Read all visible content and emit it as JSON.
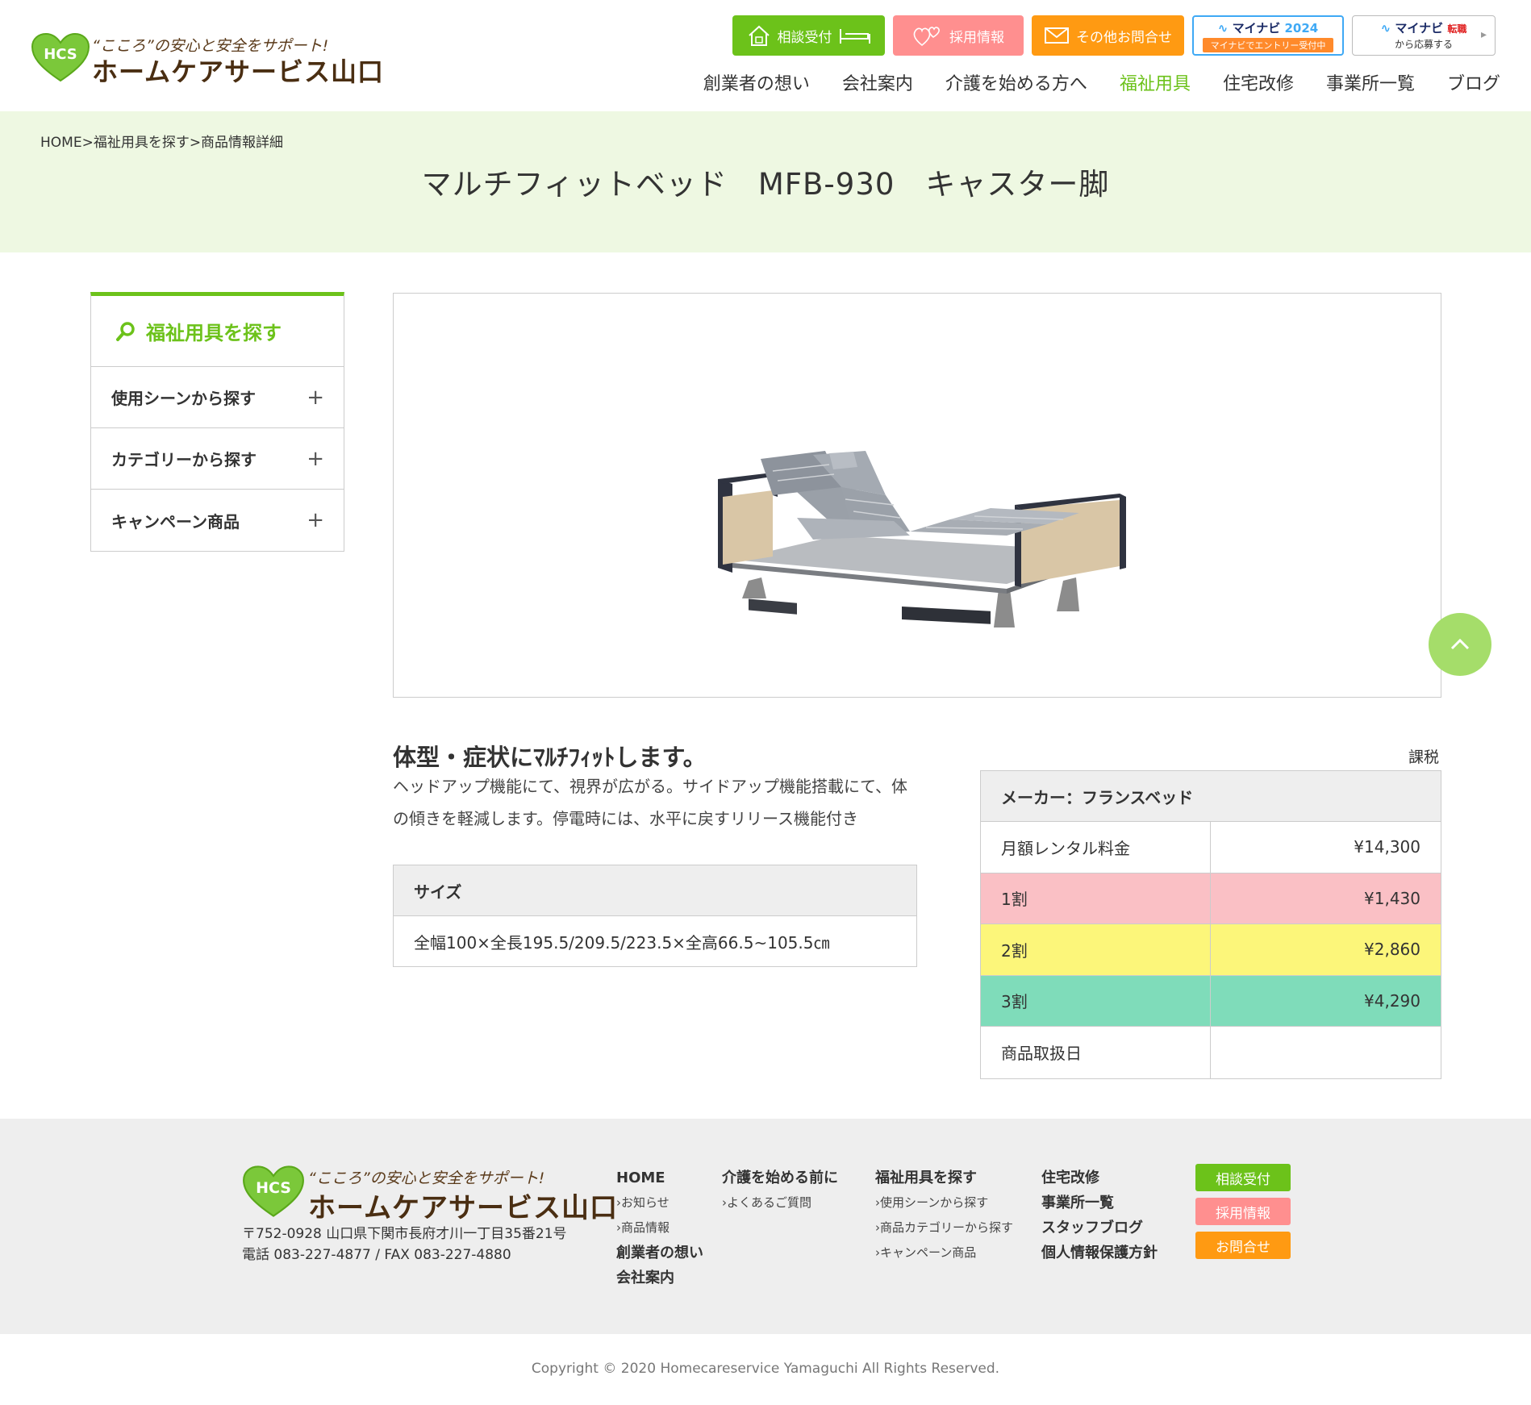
{
  "header": {
    "logo_tagline": "“こころ”の安心と安全をサポート!",
    "logo_name": "ホームケアサービス山口",
    "logo_mark": "HCS",
    "buttons": {
      "consult": "相談受付",
      "recruit": "採用情報",
      "contact": "その他お問合せ"
    },
    "mynavi": {
      "brand": "マイナビ",
      "year": "2024",
      "banner": "マイナビでエントリー受付中"
    },
    "mynavi_tenshoku": {
      "brand": "マイナビ",
      "badge": "転職",
      "sub": "から応募する"
    },
    "nav": [
      "創業者の想い",
      "会社案内",
      "介護を始める方へ",
      "福祉用具",
      "住宅改修",
      "事業所一覧",
      "ブログ"
    ],
    "active_nav": "福祉用具"
  },
  "breadcrumb": "HOME>福祉用具を探す>商品情報詳細",
  "page_title": "マルチフィットベッド　MFB-930　キャスター脚",
  "sidebar": {
    "heading": "福祉用具を探す",
    "items": [
      "使用シーンから探す",
      "カテゴリーから探す",
      "キャンペーン商品"
    ]
  },
  "product": {
    "catch": "体型・症状にﾏﾙﾁﾌｨｯﾄします。",
    "description": "ヘッドアップ機能にて、視界が広がる。サイドアップ機能搭載にて、体の傾きを軽減します。停電時には、水平に戻すリリース機能付き",
    "size_label": "サイズ",
    "size_value": "全幅100×全長195.5/209.5/223.5×全高66.5~105.5㎝"
  },
  "price": {
    "tax": "課税",
    "maker": "メーカー：フランスベッド",
    "rows": [
      {
        "label": "月額レンタル料金",
        "value": "¥14,300",
        "color": "#ffffff"
      },
      {
        "label": "1割",
        "value": "¥1,430",
        "color": "#fac0c5"
      },
      {
        "label": "2割",
        "value": "¥2,860",
        "color": "#fcf67a"
      },
      {
        "label": "3割",
        "value": "¥4,290",
        "color": "#7fdcba"
      },
      {
        "label": "商品取扱日",
        "value": "",
        "color": "#ffffff"
      }
    ]
  },
  "footer": {
    "logo_tagline": "“こころ”の安心と安全をサポート!",
    "logo_name": "ホームケアサービス山口",
    "logo_mark": "HCS",
    "address": "〒752-0928 山口県下関市長府才川一丁目35番21号",
    "phone": "電話 083-227-4877 / FAX 083-227-4880",
    "col1": {
      "h1": "HOME",
      "s1": "お知らせ",
      "s2": "商品情報",
      "h2": "創業者の想い",
      "h3": "会社案内"
    },
    "col2": {
      "h1": "介護を始める前に",
      "s1": "よくあるご質問"
    },
    "col3": {
      "h1": "福祉用具を探す",
      "s1": "使用シーンから探す",
      "s2": "商品カテゴリーから探す",
      "s3": "キャンペーン商品"
    },
    "col4": {
      "h1": "住宅改修",
      "h2": "事業所一覧",
      "h3": "スタッフブログ",
      "h4": "個人情報保護方針"
    },
    "buttons": {
      "consult": "相談受付",
      "recruit": "採用情報",
      "contact": "お問合せ"
    }
  },
  "copyright": "Copyright © 2020 Homecareservice Yamaguchi All Rights Reserved.",
  "colors": {
    "brand_green": "#6cc21a",
    "pink": "#ff8f8f",
    "orange": "#ff9a12",
    "band": "#eef8e2"
  }
}
